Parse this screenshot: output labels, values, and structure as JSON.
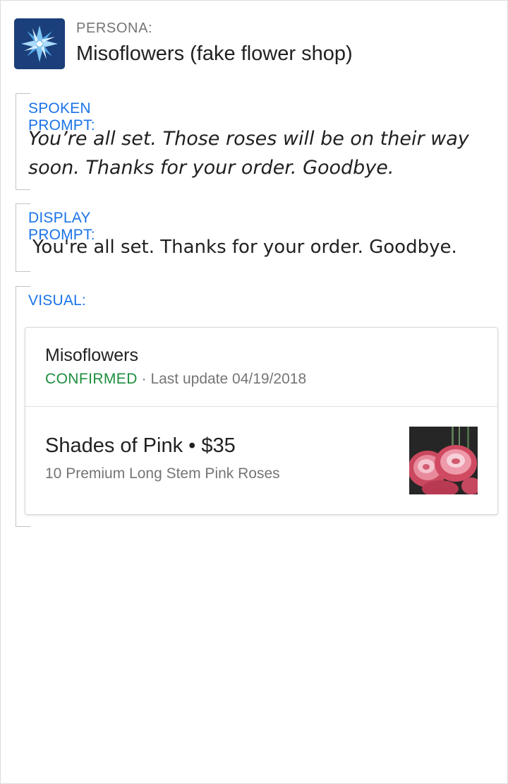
{
  "persona": {
    "label": "PERSONA:",
    "name": "Misoflowers (fake flower shop)",
    "logo_icon": "starburst-logo-icon"
  },
  "spoken": {
    "label": "SPOKEN PROMPT:",
    "text": "You’re all set. Those roses will be on their way soon. Thanks for your order. Goodbye."
  },
  "display": {
    "label": "DISPLAY PROMPT:",
    "text": "You're all set. Thanks for your order. Goodbye."
  },
  "visual": {
    "label": "VISUAL:"
  },
  "card": {
    "title": "Misoflowers",
    "status": "CONFIRMED",
    "separator": " · ",
    "last_update": "Last update 04/19/2018",
    "item": {
      "name": "Shades of Pink",
      "bullet": " • ",
      "price": "$35",
      "description": "10 Premium Long Stem Pink Roses",
      "image_icon": "pink-roses-photo"
    }
  },
  "colors": {
    "label_blue": "#1a73e8",
    "confirmed_green": "#1e8e3e",
    "logo_navy": "#1a3f7a"
  }
}
